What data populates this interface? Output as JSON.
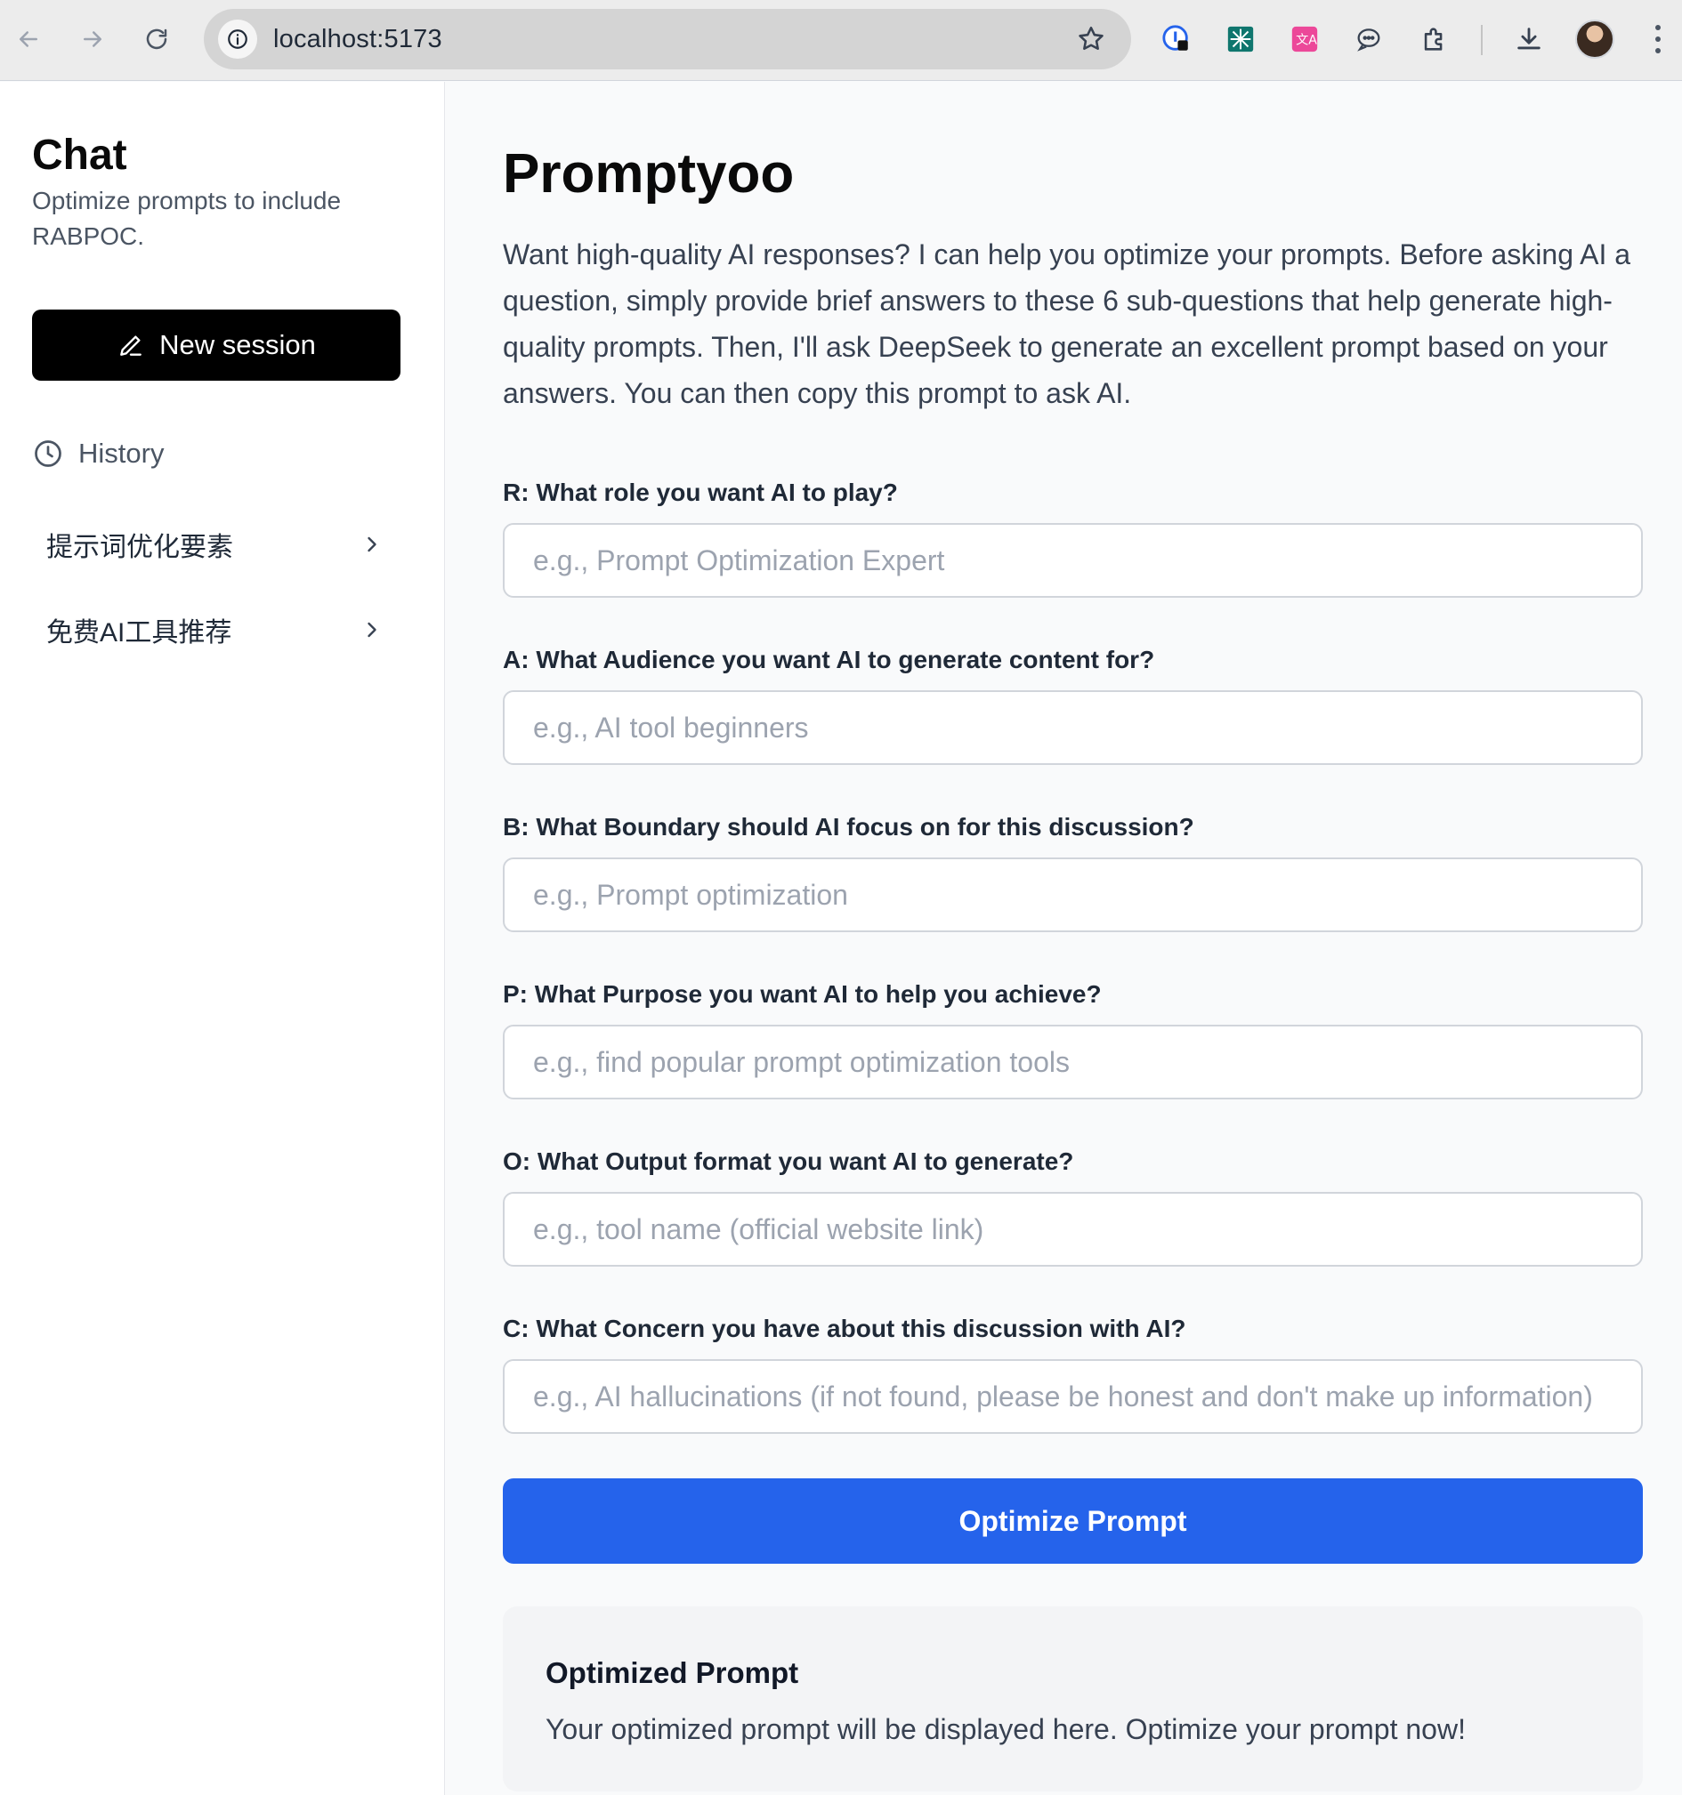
{
  "browser": {
    "url": "localhost:5173"
  },
  "sidebar": {
    "title": "Chat",
    "subtitle": "Optimize prompts to include RABPOC.",
    "new_session_label": "New session",
    "history_label": "History",
    "history_items": [
      {
        "label": "提示词优化要素"
      },
      {
        "label": "免费AI工具推荐"
      }
    ]
  },
  "main": {
    "title": "Promptyoo",
    "intro": "Want high-quality AI responses? I can help you optimize your prompts. Before asking AI a question, simply provide brief answers to these 6 sub-questions that help generate high-quality prompts. Then, I'll ask DeepSeek to generate an excellent prompt based on your answers. You can then copy this prompt to ask AI.",
    "fields": [
      {
        "label": "R: What role you want AI to play?",
        "placeholder": "e.g., Prompt Optimization Expert",
        "value": ""
      },
      {
        "label": "A: What Audience you want AI to generate content for?",
        "placeholder": "e.g., AI tool beginners",
        "value": ""
      },
      {
        "label": "B: What Boundary should AI focus on for this discussion?",
        "placeholder": "e.g., Prompt optimization",
        "value": ""
      },
      {
        "label": "P: What Purpose you want AI to help you achieve?",
        "placeholder": "e.g., find popular prompt optimization tools",
        "value": ""
      },
      {
        "label": "O: What Output format you want AI to generate?",
        "placeholder": "e.g., tool name (official website link)",
        "value": ""
      },
      {
        "label": "C: What Concern you have about this discussion with AI?",
        "placeholder": "e.g., AI hallucinations (if not found, please be honest and don't make up information)",
        "value": ""
      }
    ],
    "optimize_button_label": "Optimize Prompt",
    "result": {
      "title": "Optimized Prompt",
      "text": "Your optimized prompt will be displayed here. Optimize your prompt now!"
    }
  },
  "colors": {
    "primary": "#2563eb",
    "new_session_bg": "#000000",
    "page_bg": "#f9fafb",
    "result_bg": "#f3f4f6"
  }
}
